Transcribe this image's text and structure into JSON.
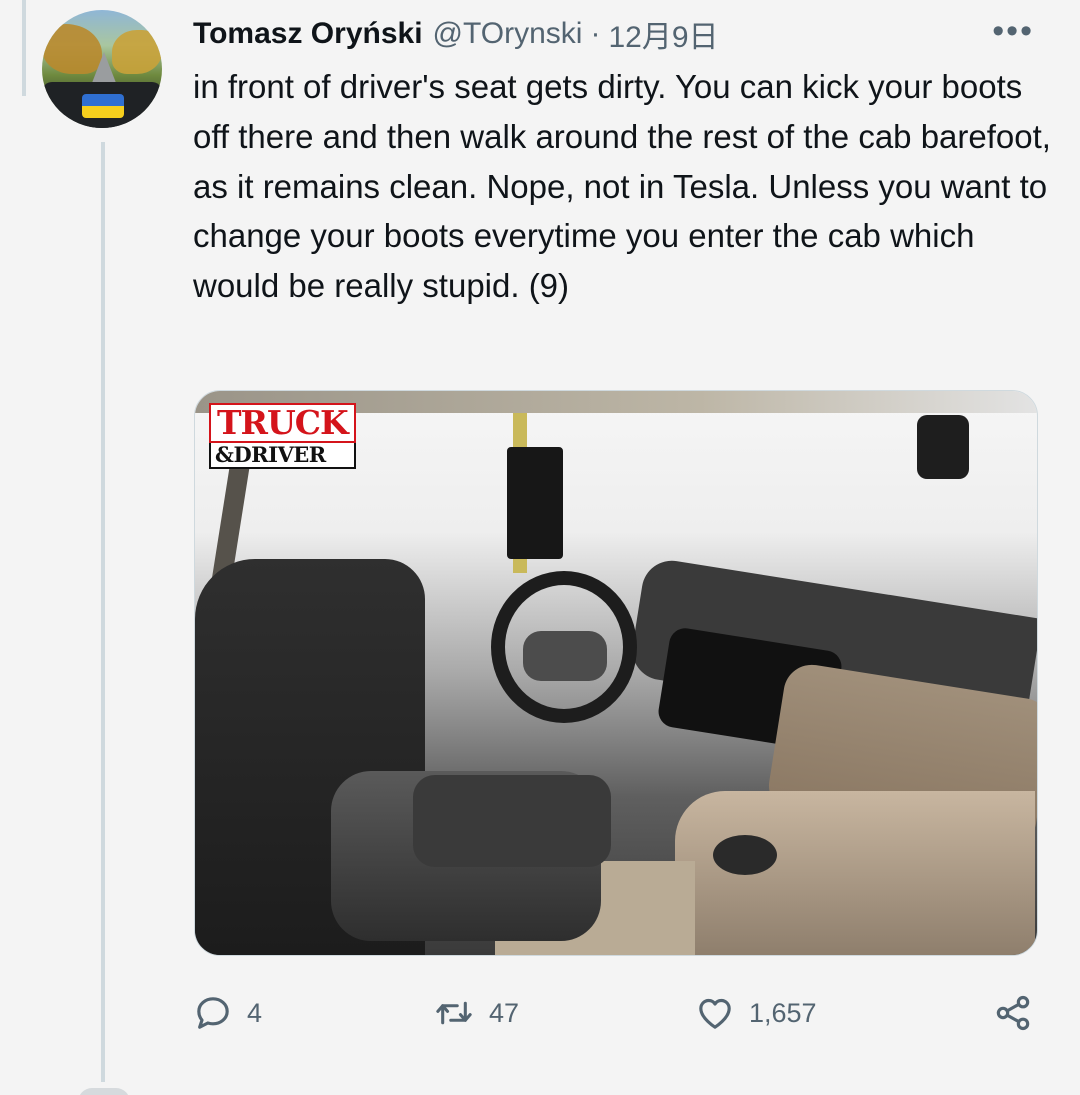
{
  "tweet": {
    "author_name": "Tomasz Oryński",
    "handle": "@TOrynski",
    "separator": "·",
    "date": "12月9日",
    "more_label": "•••",
    "text": "in front of driver's seat gets dirty. You can kick your boots off there and then walk around the rest of the cab barefoot, as it remains clean. Nope, not in Tesla. Unless you want to change your boots everytime you enter the cab which would be really stupid. (9)"
  },
  "media": {
    "logo_top": "TRUCK",
    "logo_bottom": "&DRIVER"
  },
  "actions": {
    "reply": {
      "icon": "reply-icon",
      "count": "4"
    },
    "retweet": {
      "icon": "retweet-icon",
      "count": "47"
    },
    "like": {
      "icon": "heart-icon",
      "count": "1,657"
    },
    "share": {
      "icon": "share-icon"
    }
  },
  "colors": {
    "text": "#0f1419",
    "muted": "#536471",
    "background": "#f4f4f4",
    "thread_line": "#cfd9de",
    "logo_red": "#d4141b"
  }
}
